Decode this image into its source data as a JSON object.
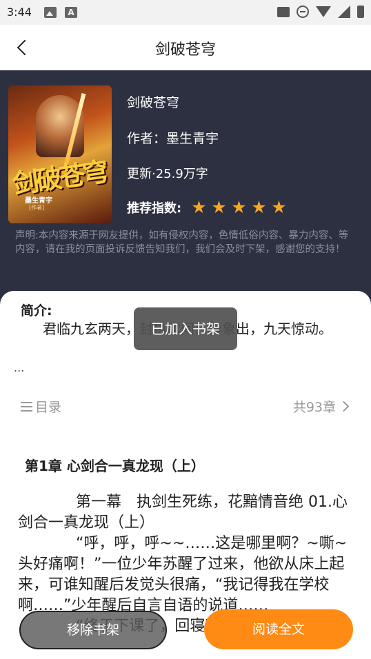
{
  "status_bar": {
    "time": "3:44",
    "a_icon": "A"
  },
  "header": {
    "title": "剑破苍穹",
    "back_icon": "chevron-left-icon"
  },
  "book": {
    "cover_title": "剑破苍穹",
    "cover_author": "墨生青宇",
    "cover_tag": "[作者]",
    "name": "剑破苍穹",
    "author_line": "作者：墨生青宇",
    "update_line": "更新·25.9万字",
    "rating_label": "推荐指数:",
    "rating_stars": 5,
    "star_glyph": "★",
    "star_color": "#f5a623",
    "disclaimer": "声明:本内容来源于网友提供，如有侵权内容，色情低俗内容、暴力内容、等内容，请在我的页面投诉反馈告知我们，我们会及时下架，感谢您的支持！"
  },
  "intro": {
    "label": "简介:",
    "text": "君临九玄两天，封执掌间！异象出，九天惊动。",
    "ellipsis": "..."
  },
  "toc": {
    "label": "目录",
    "count": "共93章"
  },
  "chapter": {
    "title": "第1章 心剑合一真龙现（上）",
    "paragraphs": [
      "第一幕　执剑生死练，花黯情音绝 01.心剑合一真龙现（上）",
      "“呼，呼，呼~~……这是哪里啊？~嘶~头好痛啊！”一位少年苏醒了过来，他欲从床上起来，可谁知醒后发觉头很痛，“我记得我在学校啊……”少年醒后自言自语的说道……",
      "“终于下课了，回寝室睡觉去咯"
    ]
  },
  "toast": "已加入书架",
  "buttons": {
    "remove": "移除书架",
    "read": "阅读全文"
  },
  "colors": {
    "header_bg": "#2c3040",
    "accent": "#ff8a14"
  }
}
